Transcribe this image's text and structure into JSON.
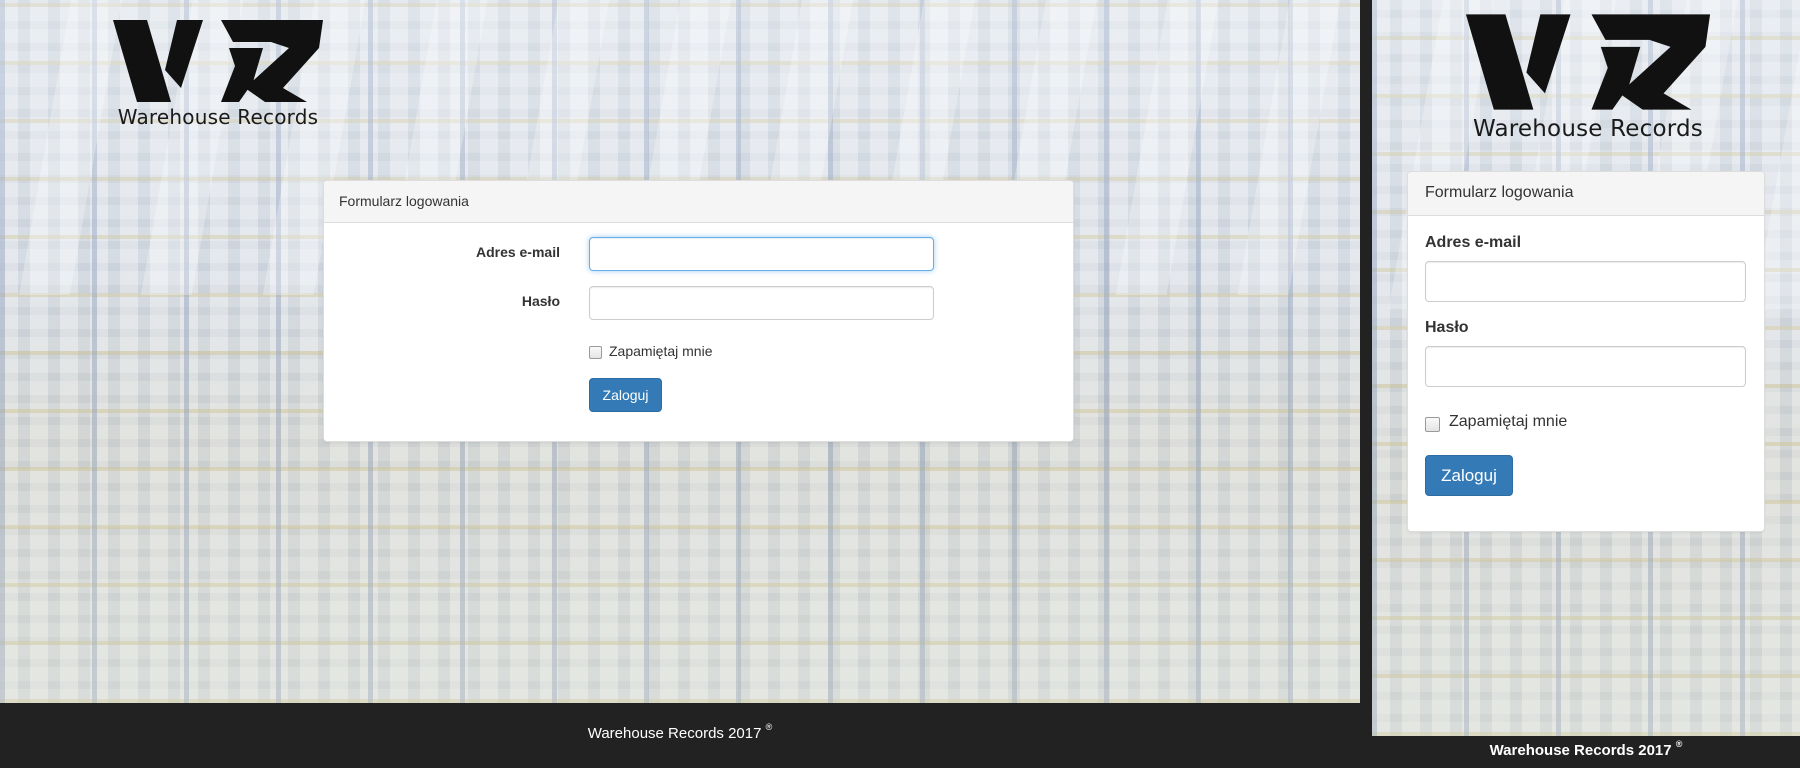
{
  "brand": {
    "name": "Warehouse Records",
    "logo_icon": "wr-monogram"
  },
  "login_form": {
    "heading": "Formularz logowania",
    "email_label": "Adres e-mail",
    "email_value": "",
    "password_label": "Hasło",
    "password_value": "",
    "remember_label": "Zapamiętaj mnie",
    "remember_checked": false,
    "submit_label": "Zaloguj"
  },
  "footer": {
    "text": "Warehouse Records 2017",
    "mark": "®"
  },
  "colors": {
    "primary": "#337ab7",
    "footer_bg": "#222222",
    "focus_border": "#66afe9"
  }
}
